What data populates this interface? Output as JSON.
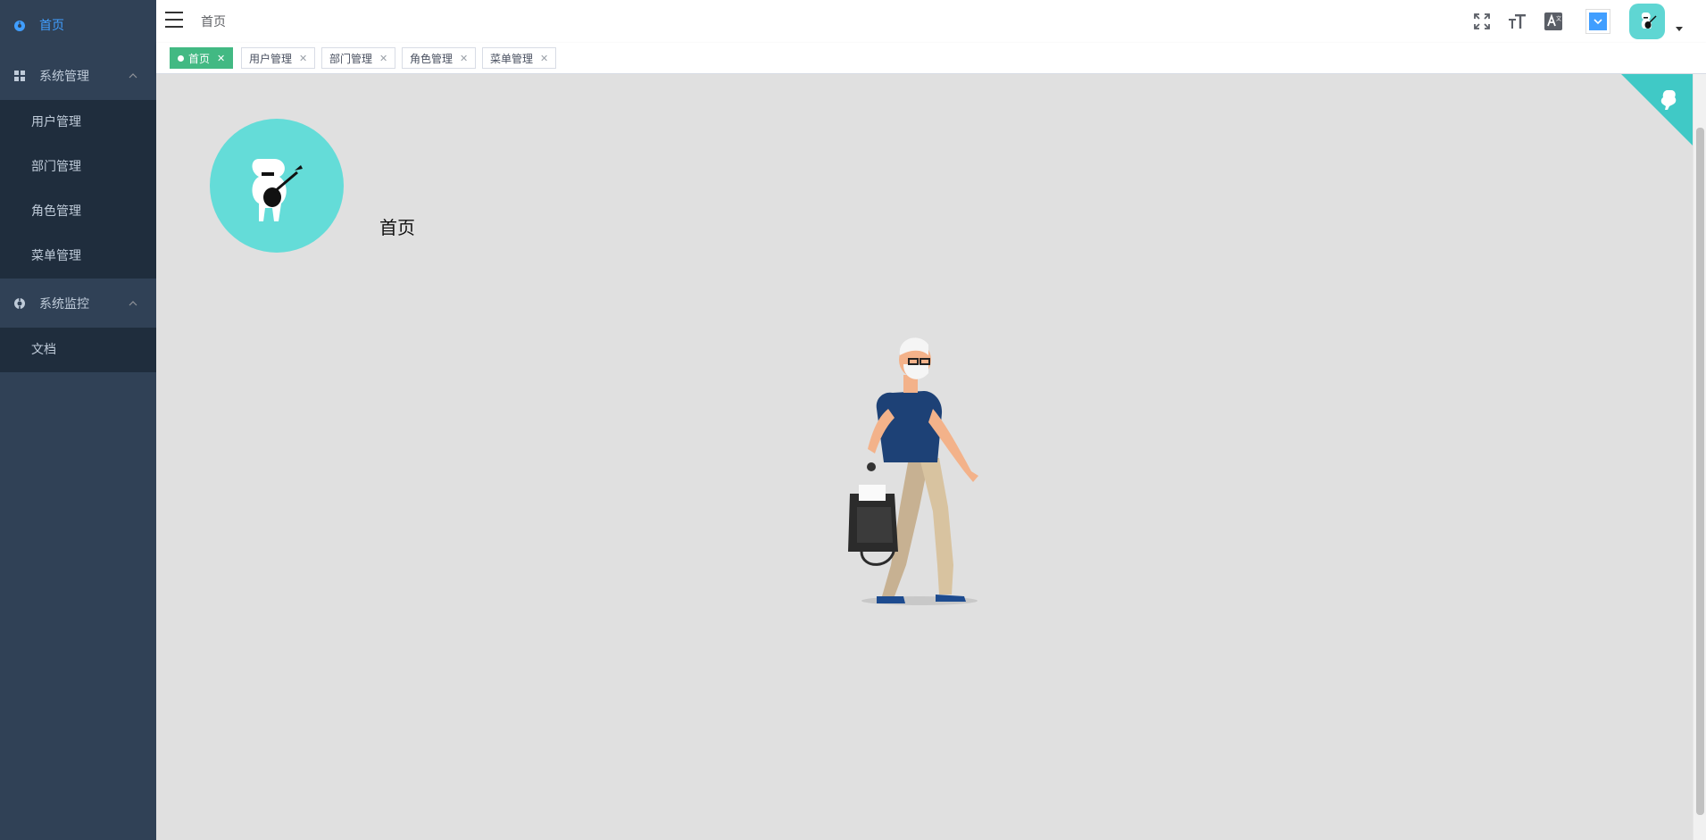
{
  "sidebar": {
    "home": "首页",
    "system_manage": {
      "label": "系统管理",
      "items": [
        "用户管理",
        "部门管理",
        "角色管理",
        "菜单管理"
      ]
    },
    "system_monitor": {
      "label": "系统监控",
      "items": [
        "文档"
      ]
    }
  },
  "navbar": {
    "breadcrumb": "首页",
    "icons": [
      "fullscreen-icon",
      "font-size-icon",
      "translate-icon"
    ]
  },
  "tags": [
    {
      "label": "首页",
      "active": true
    },
    {
      "label": "用户管理",
      "active": false
    },
    {
      "label": "部门管理",
      "active": false
    },
    {
      "label": "角色管理",
      "active": false
    },
    {
      "label": "菜单管理",
      "active": false
    }
  ],
  "main": {
    "role_label": "首页"
  },
  "colors": {
    "sidebar_bg": "#304156",
    "submenu_bg": "#1f2d3d",
    "active_tag": "#42b983",
    "accent": "#409eff",
    "avatar_bg": "#64dcd8"
  }
}
